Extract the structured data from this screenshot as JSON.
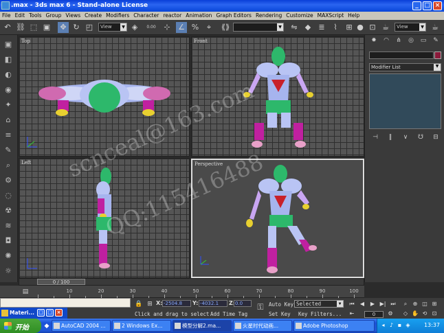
{
  "title_bar": {
    "title": ".max - 3ds max 6 - Stand-alone License",
    "buttons": [
      "_",
      "□",
      "×"
    ]
  },
  "menu": [
    "File",
    "Edit",
    "Tools",
    "Group",
    "Views",
    "Create",
    "Modifiers",
    "Character",
    "reactor",
    "Animation",
    "Graph Editors",
    "Rendering",
    "Customize",
    "MAXScript",
    "Help"
  ],
  "toolbar": {
    "view_dropdown_1": "View",
    "view_dropdown_2": "View",
    "spinner_value": "0.00",
    "selection_set": ""
  },
  "viewports": {
    "top": "Top",
    "front": "Front",
    "left": "Left",
    "perspective": "Perspective"
  },
  "command_panel": {
    "modifier_list": "Modifier List"
  },
  "timeline": {
    "frame_display": "0 / 100",
    "ticks": [
      "10",
      "20",
      "30",
      "40",
      "50",
      "60",
      "70",
      "80",
      "90",
      "100"
    ]
  },
  "material_window": {
    "label": "Materi..."
  },
  "status": {
    "x_label": "X:",
    "x_value": "-2504.8",
    "y_label": "Y:",
    "y_value": "-4032.1",
    "z_label": "Z:",
    "z_value": "0.0",
    "prompt": "Click and drag to select",
    "add_time_tag": "Add Time Tag",
    "auto_key": "Auto Key",
    "set_key": "Set Key",
    "key_mode": "Selected",
    "key_filters": "Key Filters...",
    "frame": "0"
  },
  "watermark": {
    "line1": "scnceal@163.com",
    "line2": "QQ:115416488"
  },
  "taskbar": {
    "start": "开始",
    "tasks": [
      "AutoCAD 2004 ...",
      "2 Windows Ex...",
      "模型分解2.ma...",
      "火星时代动画...",
      "Adobe Photoshop"
    ],
    "clock": "13:37"
  },
  "colors": {
    "title_blue": "#0a3fd8",
    "viewport_gray": "#555555",
    "stack_blue": "#314a5a",
    "object_color": "#8a1a3a"
  }
}
